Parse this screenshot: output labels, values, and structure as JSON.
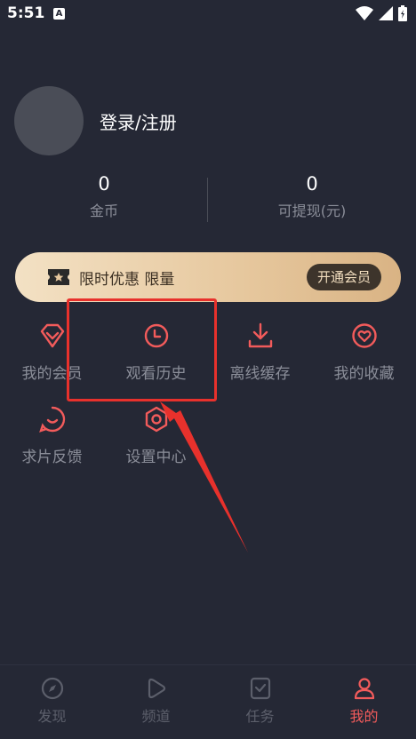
{
  "status_bar": {
    "time": "5:51",
    "notification_letter": "A"
  },
  "profile": {
    "login_text": "登录/注册"
  },
  "stats": [
    {
      "value": "0",
      "label": "金币"
    },
    {
      "value": "0",
      "label": "可提现(元)"
    }
  ],
  "vip_banner": {
    "text": "限时优惠 限量",
    "button_label": "开通会员"
  },
  "menu": [
    {
      "label": "我的会员",
      "icon": "diamond-icon"
    },
    {
      "label": "观看历史",
      "icon": "clock-icon"
    },
    {
      "label": "离线缓存",
      "icon": "download-icon"
    },
    {
      "label": "我的收藏",
      "icon": "heart-icon"
    },
    {
      "label": "求片反馈",
      "icon": "feedback-icon"
    },
    {
      "label": "设置中心",
      "icon": "settings-icon"
    }
  ],
  "tabs": [
    {
      "label": "发现",
      "icon": "compass-icon",
      "active": false
    },
    {
      "label": "频道",
      "icon": "play-icon",
      "active": false
    },
    {
      "label": "任务",
      "icon": "task-icon",
      "active": false
    },
    {
      "label": "我的",
      "icon": "user-icon",
      "active": true
    }
  ],
  "colors": {
    "background": "#252835",
    "accent": "#f25b5b",
    "annotation": "#e8312c",
    "muted_text": "#8b8e99"
  }
}
